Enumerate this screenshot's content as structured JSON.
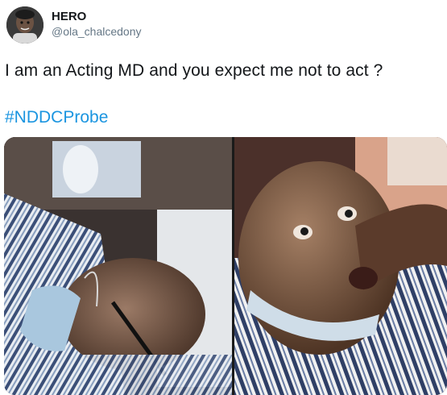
{
  "user": {
    "display_name": "HERO",
    "handle": "@ola_chalcedony",
    "avatar_icon": "user-avatar-icon"
  },
  "tweet": {
    "text": "I am an Acting MD and you expect me not to act ?",
    "hashtag": "#NDDCProbe"
  },
  "colors": {
    "hashtag": "#1b95e0",
    "handle": "#657786",
    "text": "#14171a"
  }
}
